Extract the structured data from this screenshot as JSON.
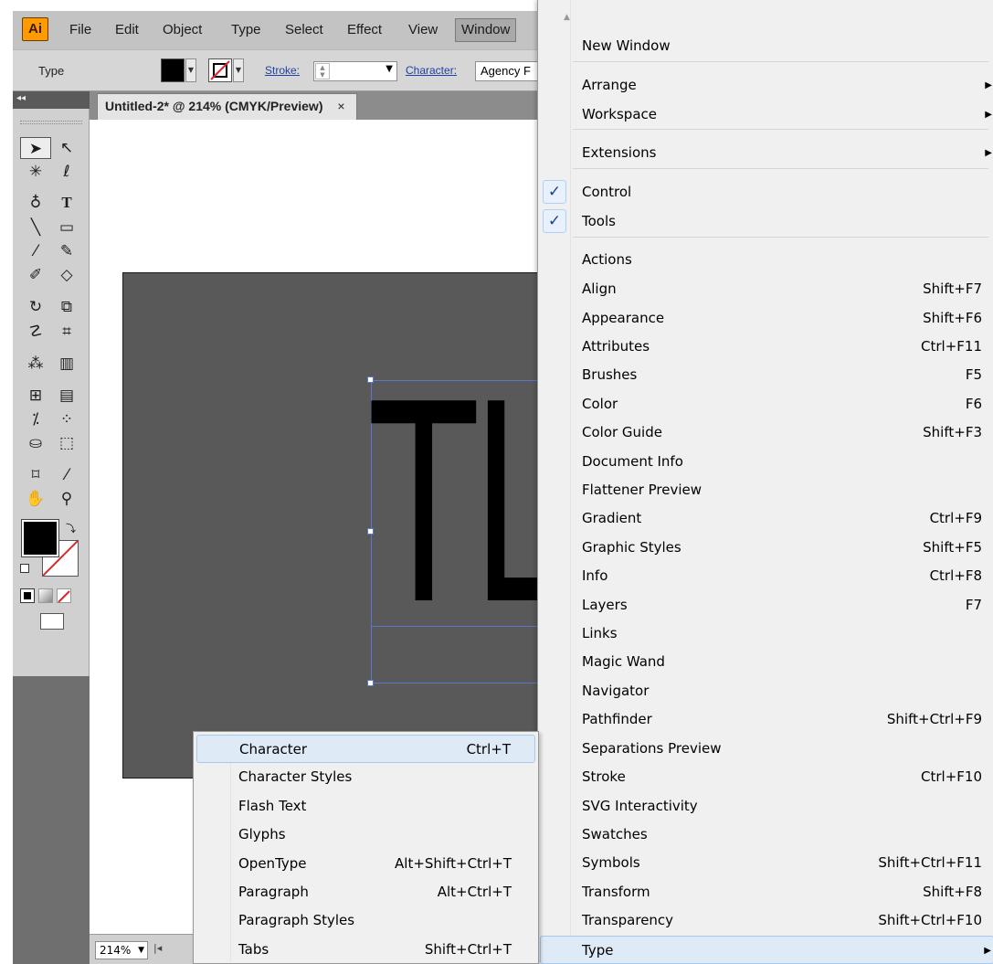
{
  "app": {
    "logo": "Ai",
    "menu": [
      "File",
      "Edit",
      "Object",
      "Type",
      "Select",
      "Effect",
      "View",
      "Window"
    ],
    "active_menu": "Window"
  },
  "control_panel": {
    "tool_label": "Type",
    "stroke_label": "Stroke:",
    "character_label": "Character:",
    "font_value": "Agency F"
  },
  "document": {
    "tab_title": "Untitled-2* @ 214% (CMYK/Preview)",
    "close_glyph": "×",
    "canvas_text": "TL",
    "zoom": "214%"
  },
  "window_menu": {
    "items": [
      {
        "label": "New Window",
        "shortcut": ""
      },
      {
        "label": "Arrange",
        "shortcut": "",
        "submenu": true
      },
      {
        "label": "Workspace",
        "shortcut": "",
        "submenu": true
      },
      {
        "label": "Extensions",
        "shortcut": "",
        "submenu": true
      },
      {
        "label": "Control",
        "shortcut": "",
        "checked": true
      },
      {
        "label": "Tools",
        "shortcut": "",
        "checked": true
      },
      {
        "label": "Actions",
        "shortcut": ""
      },
      {
        "label": "Align",
        "shortcut": "Shift+F7"
      },
      {
        "label": "Appearance",
        "shortcut": "Shift+F6"
      },
      {
        "label": "Attributes",
        "shortcut": "Ctrl+F11"
      },
      {
        "label": "Brushes",
        "shortcut": "F5"
      },
      {
        "label": "Color",
        "shortcut": "F6"
      },
      {
        "label": "Color Guide",
        "shortcut": "Shift+F3"
      },
      {
        "label": "Document Info",
        "shortcut": ""
      },
      {
        "label": "Flattener Preview",
        "shortcut": ""
      },
      {
        "label": "Gradient",
        "shortcut": "Ctrl+F9"
      },
      {
        "label": "Graphic Styles",
        "shortcut": "Shift+F5"
      },
      {
        "label": "Info",
        "shortcut": "Ctrl+F8"
      },
      {
        "label": "Layers",
        "shortcut": "F7"
      },
      {
        "label": "Links",
        "shortcut": ""
      },
      {
        "label": "Magic Wand",
        "shortcut": ""
      },
      {
        "label": "Navigator",
        "shortcut": ""
      },
      {
        "label": "Pathfinder",
        "shortcut": "Shift+Ctrl+F9"
      },
      {
        "label": "Separations Preview",
        "shortcut": ""
      },
      {
        "label": "Stroke",
        "shortcut": "Ctrl+F10"
      },
      {
        "label": "SVG Interactivity",
        "shortcut": ""
      },
      {
        "label": "Swatches",
        "shortcut": ""
      },
      {
        "label": "Symbols",
        "shortcut": "Shift+Ctrl+F11"
      },
      {
        "label": "Transform",
        "shortcut": "Shift+F8"
      },
      {
        "label": "Transparency",
        "shortcut": "Shift+Ctrl+F10"
      },
      {
        "label": "Type",
        "shortcut": "",
        "submenu": true,
        "highlighted": true
      }
    ]
  },
  "type_submenu": {
    "items": [
      {
        "label": "Character",
        "shortcut": "Ctrl+T",
        "highlighted": true
      },
      {
        "label": "Character Styles",
        "shortcut": ""
      },
      {
        "label": "Flash Text",
        "shortcut": ""
      },
      {
        "label": "Glyphs",
        "shortcut": ""
      },
      {
        "label": "OpenType",
        "shortcut": "Alt+Shift+Ctrl+T"
      },
      {
        "label": "Paragraph",
        "shortcut": "Alt+Ctrl+T"
      },
      {
        "label": "Paragraph Styles",
        "shortcut": ""
      },
      {
        "label": "Tabs",
        "shortcut": "Shift+Ctrl+T"
      }
    ]
  },
  "glyphs": {
    "check": "✓",
    "submenu_arrow": "▶",
    "scroll_up": "▲"
  },
  "colors": {
    "accent": "#ff9a00",
    "highlight": "#dfeaf7",
    "artboard": "#595959"
  }
}
